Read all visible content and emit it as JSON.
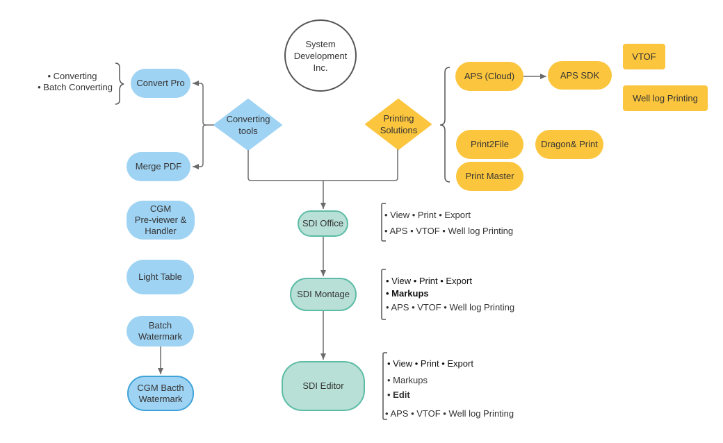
{
  "colors": {
    "blue": "#9fd3f3",
    "yellow": "#fbc53d",
    "teal_fill": "#b8e0d6",
    "teal_border": "#5dbca6",
    "connector": "#6b6b6b",
    "highlight_border": "#3fa3d9"
  },
  "company": {
    "line1": "System",
    "line2": "Development",
    "line3": "Inc."
  },
  "converting": {
    "hub": {
      "line1": "Converting",
      "line2": "tools"
    },
    "convert_pro": "Convert Pro",
    "convert_pro_features": [
      "• Converting",
      "• Batch Converting"
    ],
    "merge_pdf": "Merge PDF",
    "cgm_previewer": {
      "line1": "CGM",
      "line2": "Pre-viewer &",
      "line3": "Handler"
    },
    "light_table": "Light Table",
    "batch_watermark": {
      "line1": "Batch",
      "line2": "Watermark"
    },
    "cgm_batch_watermark": {
      "line1": "CGM Bacth",
      "line2": "Watermark"
    }
  },
  "printing": {
    "hub": {
      "line1": "Printing",
      "line2": "Solutions"
    },
    "aps_cloud": "APS (Cloud)",
    "aps_sdk": "APS SDK",
    "vtof": "VTOF",
    "well_log_printing": "Well log Printing",
    "print2file": "Print2File",
    "dragon_print": "Dragon& Print",
    "print_master": "Print Master"
  },
  "products": {
    "sdi_office": {
      "label": "SDI Office",
      "features": [
        "• View • Print • Export",
        "• APS • VTOF • Well log Printing"
      ]
    },
    "sdi_montage": {
      "label": "SDI Montage",
      "features": [
        "• View • Print • Export",
        "• Markups",
        "• APS • VTOF • Well log Printing"
      ]
    },
    "sdi_editor": {
      "label": "SDI Editor",
      "features": [
        "• View • Print • Export",
        "• Markups",
        "• Edit",
        "• APS • VTOF • Well log Printing"
      ]
    }
  }
}
